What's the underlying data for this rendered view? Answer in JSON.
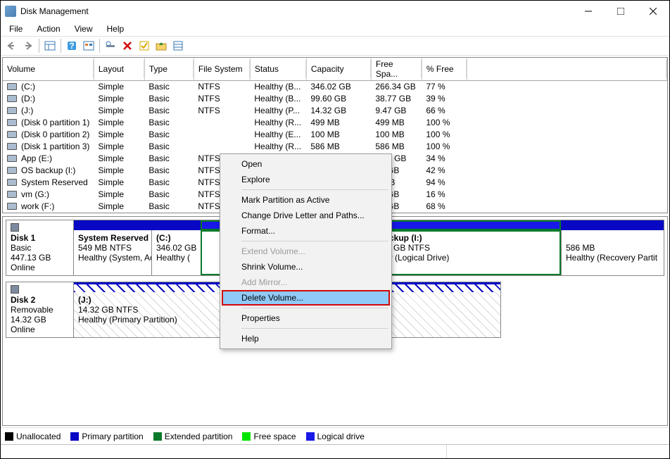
{
  "window_title": "Disk Management",
  "menu": [
    "File",
    "Action",
    "View",
    "Help"
  ],
  "columns": [
    "Volume",
    "Layout",
    "Type",
    "File System",
    "Status",
    "Capacity",
    "Free Spa...",
    "% Free"
  ],
  "volumes": [
    {
      "name": "(C:)",
      "layout": "Simple",
      "ptype": "Basic",
      "fs": "NTFS",
      "status": "Healthy (B...",
      "cap": "346.02 GB",
      "free": "266.34 GB",
      "pct": "77 %"
    },
    {
      "name": "(D:)",
      "layout": "Simple",
      "ptype": "Basic",
      "fs": "NTFS",
      "status": "Healthy (B...",
      "cap": "99.60 GB",
      "free": "38.77 GB",
      "pct": "39 %"
    },
    {
      "name": "(J:)",
      "layout": "Simple",
      "ptype": "Basic",
      "fs": "NTFS",
      "status": "Healthy (P...",
      "cap": "14.32 GB",
      "free": "9.47 GB",
      "pct": "66 %"
    },
    {
      "name": "(Disk 0 partition 1)",
      "layout": "Simple",
      "ptype": "Basic",
      "fs": "",
      "status": "Healthy (R...",
      "cap": "499 MB",
      "free": "499 MB",
      "pct": "100 %"
    },
    {
      "name": "(Disk 0 partition 2)",
      "layout": "Simple",
      "ptype": "Basic",
      "fs": "",
      "status": "Healthy (E...",
      "cap": "100 MB",
      "free": "100 MB",
      "pct": "100 %"
    },
    {
      "name": "(Disk 1 partition 3)",
      "layout": "Simple",
      "ptype": "Basic",
      "fs": "",
      "status": "Healthy (R...",
      "cap": "586 MB",
      "free": "586 MB",
      "pct": "100 %"
    },
    {
      "name": "App (E:)",
      "layout": "Simple",
      "ptype": "Basic",
      "fs": "NTFS",
      "status": "",
      "cap": "",
      "free": "3.87 GB",
      "pct": "34 %"
    },
    {
      "name": "OS backup (I:)",
      "layout": "Simple",
      "ptype": "Basic",
      "fs": "NTFS",
      "status": "",
      "cap": "",
      "free": "52 GB",
      "pct": "42 %"
    },
    {
      "name": "System Reserved",
      "layout": "Simple",
      "ptype": "Basic",
      "fs": "NTFS",
      "status": "",
      "cap": "",
      "free": "4 MB",
      "pct": "94 %"
    },
    {
      "name": "vm (G:)",
      "layout": "Simple",
      "ptype": "Basic",
      "fs": "NTFS",
      "status": "",
      "cap": "",
      "free": "14 GB",
      "pct": "16 %"
    },
    {
      "name": "work (F:)",
      "layout": "Simple",
      "ptype": "Basic",
      "fs": "NTFS",
      "status": "",
      "cap": "",
      "free": "09 GB",
      "pct": "68 %"
    }
  ],
  "context_menu": {
    "open": "Open",
    "explore": "Explore",
    "mark": "Mark Partition as Active",
    "change": "Change Drive Letter and Paths...",
    "format": "Format...",
    "extend": "Extend Volume...",
    "shrink": "Shrink Volume...",
    "mirror": "Add Mirror...",
    "delete": "Delete Volume...",
    "props": "Properties",
    "help": "Help"
  },
  "disk1": {
    "header": "Disk 1",
    "type": "Basic",
    "size": "447.13 GB",
    "state": "Online",
    "p1_title": "System Reserved",
    "p1_size": "549 MB NTFS",
    "p1_state": "Healthy (System, Active",
    "p2_title": "(C:)",
    "p2_size": "346.02 GB",
    "p2_state": "Healthy (",
    "p3_title": "backup  (I:)",
    "p3_size": ".00 GB NTFS",
    "p3_state": "lthy (Logical Drive)",
    "p4_size": "586 MB",
    "p4_state": "Healthy (Recovery Partit"
  },
  "disk2": {
    "header": "Disk 2",
    "type": "Removable",
    "size": "14.32 GB",
    "state": "Online",
    "p1_title": "(J:)",
    "p1_size": "14.32 GB NTFS",
    "p1_state": "Healthy (Primary Partition)"
  },
  "legend": {
    "unalloc": "Unallocated",
    "primary": "Primary partition",
    "extended": "Extended partition",
    "free": "Free space",
    "logical": "Logical drive"
  }
}
